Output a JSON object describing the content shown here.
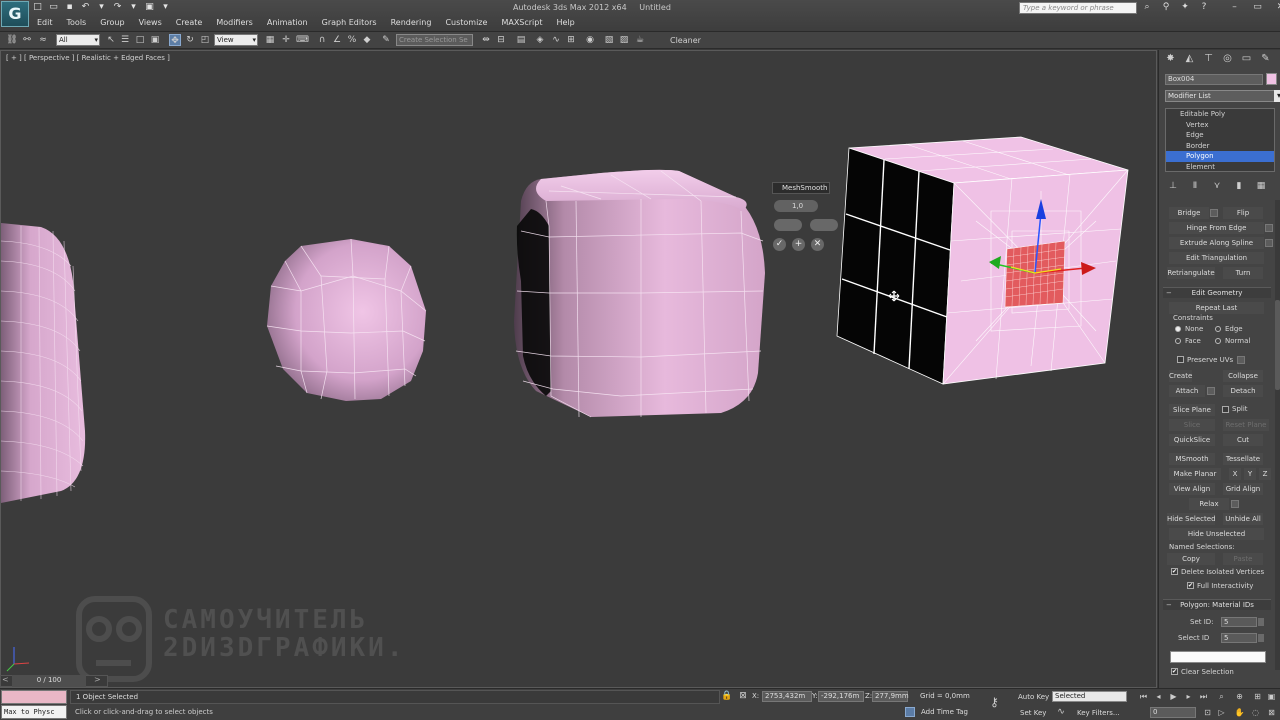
{
  "app": {
    "title": "Autodesk 3ds Max 2012 x64",
    "document": "Untitled",
    "logo": "G"
  },
  "search": {
    "placeholder": "Type a keyword or phrase"
  },
  "menu": [
    "Edit",
    "Tools",
    "Group",
    "Views",
    "Create",
    "Modifiers",
    "Animation",
    "Graph Editors",
    "Rendering",
    "Customize",
    "MAXScript",
    "Help"
  ],
  "toolbar": {
    "selection_filter": "All",
    "reference_coord": "View",
    "named_selection_placeholder": "Create Selection Se",
    "cleaner_label": "Cleaner"
  },
  "viewport": {
    "label": "[ + ] [ Perspective ] [ Realistic + Edged Faces ]",
    "watermark_line1": "САМОУЧИТЕЛЬ",
    "watermark_line2": "2DИ3DГРАФИКИ."
  },
  "caddy": {
    "title": "MeshSmooth",
    "value": "1,0"
  },
  "command_panel": {
    "object_name": "Box004",
    "object_color": "#f0c2e4",
    "modifier_list": "Modifier List",
    "stack": [
      {
        "label": "Editable Poly",
        "level": "top",
        "selected": false
      },
      {
        "label": "Vertex",
        "level": "sub",
        "selected": false
      },
      {
        "label": "Edge",
        "level": "sub",
        "selected": false
      },
      {
        "label": "Border",
        "level": "sub",
        "selected": false
      },
      {
        "label": "Polygon",
        "level": "sub",
        "selected": true
      },
      {
        "label": "Element",
        "level": "sub",
        "selected": false
      }
    ],
    "edit_polygons": {
      "bridge": "Bridge",
      "flip": "Flip",
      "hinge_from_edge": "Hinge From Edge",
      "extrude_along_spline": "Extrude Along Spline",
      "edit_triangulation": "Edit Triangulation",
      "retriangulate": "Retriangulate",
      "turn": "Turn"
    },
    "edit_geometry": {
      "header": "Edit Geometry",
      "repeat_last": "Repeat Last",
      "constraints_label": "Constraints",
      "none": "None",
      "edge": "Edge",
      "face": "Face",
      "normal": "Normal",
      "preserve_uvs": "Preserve UVs",
      "create": "Create",
      "collapse": "Collapse",
      "attach": "Attach",
      "detach": "Detach",
      "slice_plane": "Slice Plane",
      "split": "Split",
      "slice": "Slice",
      "reset_plane": "Reset Plane",
      "quickslice": "QuickSlice",
      "cut": "Cut",
      "msmooth": "MSmooth",
      "tessellate": "Tessellate",
      "make_planar": "Make Planar",
      "x": "X",
      "y": "Y",
      "z": "Z",
      "view_align": "View Align",
      "grid_align": "Grid Align",
      "relax": "Relax",
      "hide_selected": "Hide Selected",
      "unhide_all": "Unhide All",
      "hide_unselected": "Hide Unselected",
      "named_selections": "Named Selections:",
      "copy": "Copy",
      "paste": "Paste",
      "delete_isolated": "Delete Isolated Vertices",
      "full_interactivity": "Full Interactivity"
    },
    "material_ids": {
      "header": "Polygon: Material IDs",
      "set_id_label": "Set ID:",
      "set_id_value": "5",
      "select_id_label": "Select ID",
      "select_id_value": "5",
      "clear_selection": "Clear Selection"
    }
  },
  "time_slider": {
    "value": "0 / 100"
  },
  "status": {
    "maxscript": "Max to Physc",
    "selection": "1 Object Selected",
    "prompt": "Click or click-and-drag to select objects",
    "x_label": "X:",
    "x_value": "2753,432m",
    "y_label": "Y:",
    "y_value": "-292,176m",
    "z_label": "Z:",
    "z_value": "277,9mm",
    "grid": "Grid = 0,0mm",
    "add_time_tag": "Add Time Tag",
    "auto_key": "Auto Key",
    "auto_key_mode": "Selected",
    "set_key": "Set Key",
    "key_filters": "Key Filters...",
    "frame": "0"
  },
  "colors": {
    "mesh_pink": "#e6b3dc",
    "selected_faces": "#e06060",
    "stack_selected": "#3b6fd1"
  }
}
